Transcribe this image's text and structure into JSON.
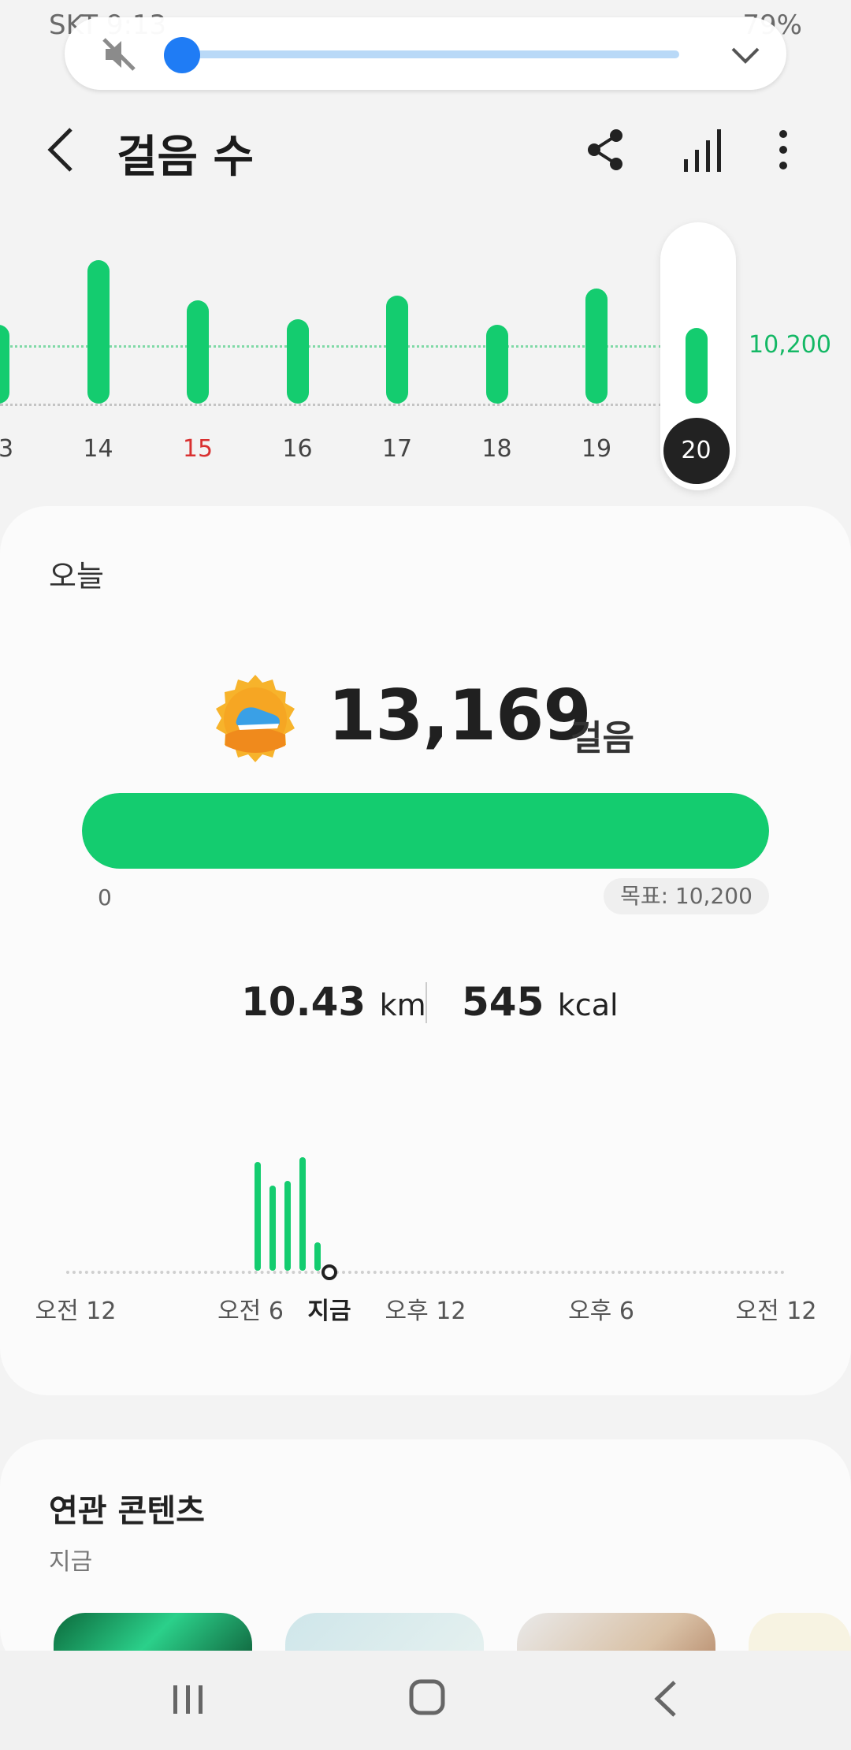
{
  "status_bar": {
    "left_text": "SKT 9:13",
    "right_text": "79%"
  },
  "header": {
    "title": "걸음 수"
  },
  "daily_chart": {
    "days": [
      {
        "label": "13",
        "fraction": 0.55,
        "highlight": "none"
      },
      {
        "label": "14",
        "fraction": 1.0,
        "highlight": "none"
      },
      {
        "label": "15",
        "fraction": 0.72,
        "highlight": "red"
      },
      {
        "label": "16",
        "fraction": 0.59,
        "highlight": "none"
      },
      {
        "label": "17",
        "fraction": 0.75,
        "highlight": "none"
      },
      {
        "label": "18",
        "fraction": 0.55,
        "highlight": "none"
      },
      {
        "label": "19",
        "fraction": 0.8,
        "highlight": "none"
      },
      {
        "label": "20",
        "fraction": 0.53,
        "highlight": "selected"
      }
    ],
    "goal_label": "10,200",
    "bar_color": "#14cc6f"
  },
  "today": {
    "label": "오늘",
    "steps": "13,169",
    "steps_unit": "걸음",
    "progress_fraction": 1.0,
    "progress_start": "0",
    "goal_text": "목표: 10,200",
    "distance_value": "10.43",
    "distance_unit": "km",
    "calories_value": "545",
    "calories_unit": "kcal"
  },
  "hourly_chart": {
    "bars": [
      {
        "hour": 6.4,
        "fraction": 0.93
      },
      {
        "hour": 6.9,
        "fraction": 0.73
      },
      {
        "hour": 7.4,
        "fraction": 0.77
      },
      {
        "hour": 7.9,
        "fraction": 0.97
      },
      {
        "hour": 8.4,
        "fraction": 0.24
      }
    ],
    "labels": [
      "오전 12",
      "오전 6",
      "지금",
      "오후 12",
      "오후 6",
      "오전 12"
    ]
  },
  "related": {
    "title": "연관 콘텐츠",
    "subtitle": "지금"
  },
  "icons": {
    "mute": "volume-mute-icon",
    "expand": "chevron-down-icon",
    "back": "back-arrow-icon",
    "share": "share-icon",
    "chart": "bar-chart-icon",
    "more": "more-vertical-icon",
    "medal": "shoe-medal-icon"
  },
  "colors": {
    "accent": "#14cc6f",
    "volume": "#1f7cf5",
    "today_date_red": "#d93030"
  }
}
